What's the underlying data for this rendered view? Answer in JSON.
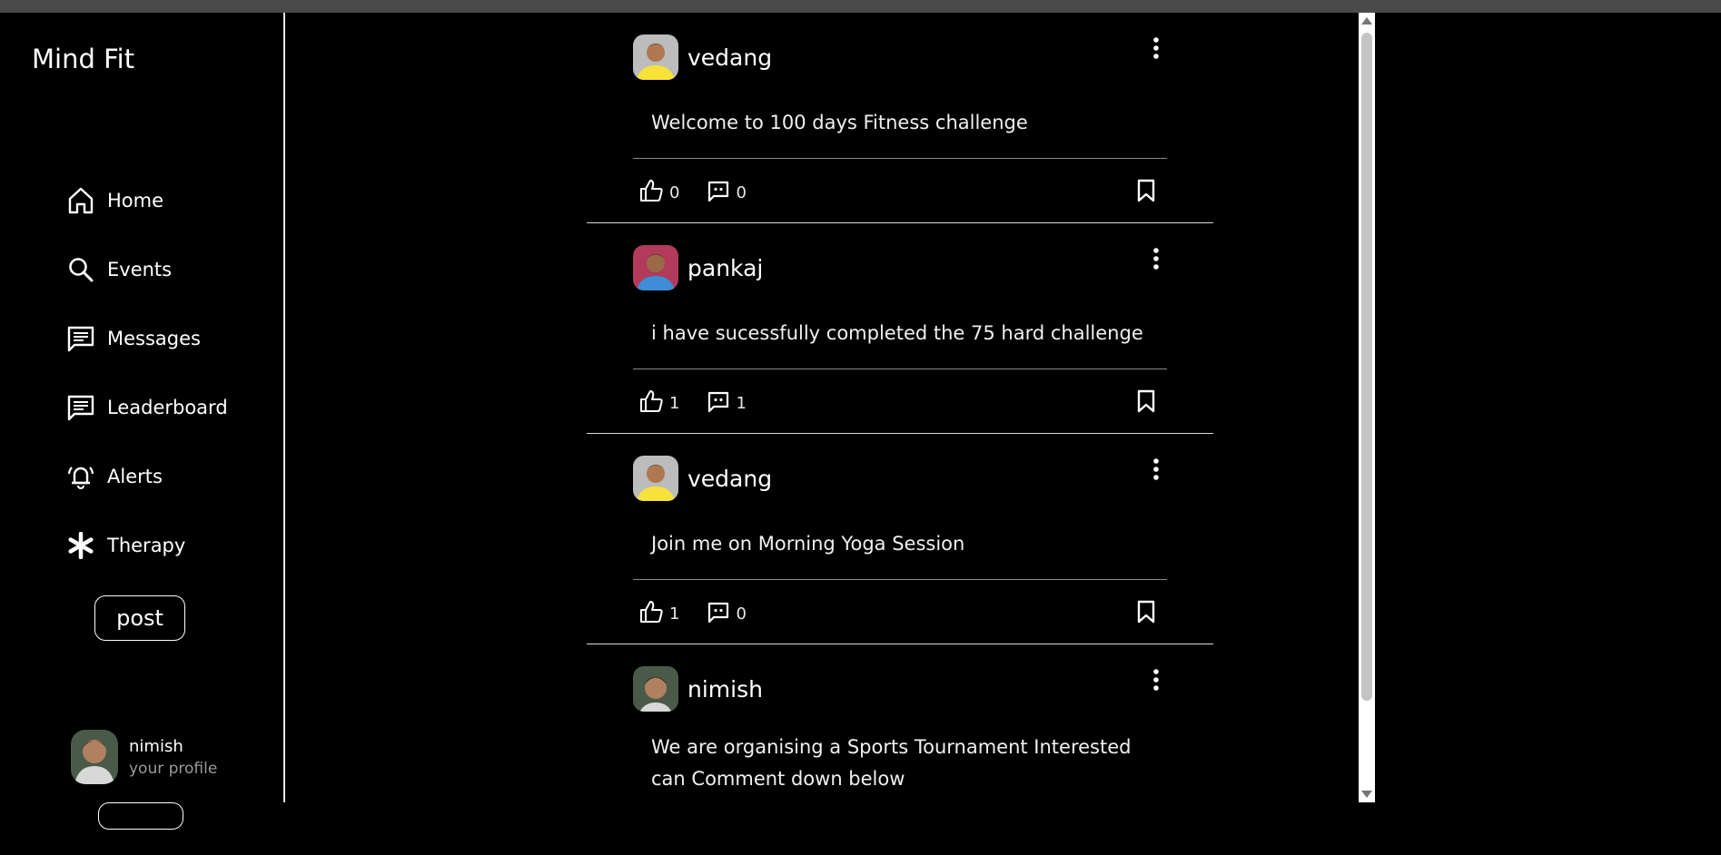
{
  "app": {
    "brand": "Mind Fit"
  },
  "sidebar": {
    "items": [
      {
        "label": "Home",
        "icon": "home-icon"
      },
      {
        "label": "Events",
        "icon": "search-icon"
      },
      {
        "label": "Messages",
        "icon": "message-icon"
      },
      {
        "label": "Leaderboard",
        "icon": "message-icon"
      },
      {
        "label": "Alerts",
        "icon": "bell-icon"
      },
      {
        "label": "Therapy",
        "icon": "asterisk-icon"
      }
    ],
    "post_button": "post",
    "profile": {
      "name": "nimish",
      "subtitle": "your profile"
    }
  },
  "posts": [
    {
      "user": "vedang",
      "text": "Welcome to 100 days Fitness challenge",
      "likes": "0",
      "comments": "0",
      "avatar_color": "#f7e23a"
    },
    {
      "user": "pankaj",
      "text": "i have sucessfully completed the 75 hard challenge",
      "likes": "1",
      "comments": "1",
      "avatar_color": "#3d8ed6"
    },
    {
      "user": "vedang",
      "text": "Join me on Morning Yoga Session",
      "likes": "1",
      "comments": "0",
      "avatar_color": "#f7e23a"
    },
    {
      "user": "nimish",
      "text": "We are organising a Sports Tournament Interested can Comment down below",
      "likes": "",
      "comments": "",
      "avatar_color": "#8a7a6a"
    }
  ],
  "colors": {
    "background": "#000000",
    "text": "#ffffff",
    "divider": "#8a8a8a"
  }
}
